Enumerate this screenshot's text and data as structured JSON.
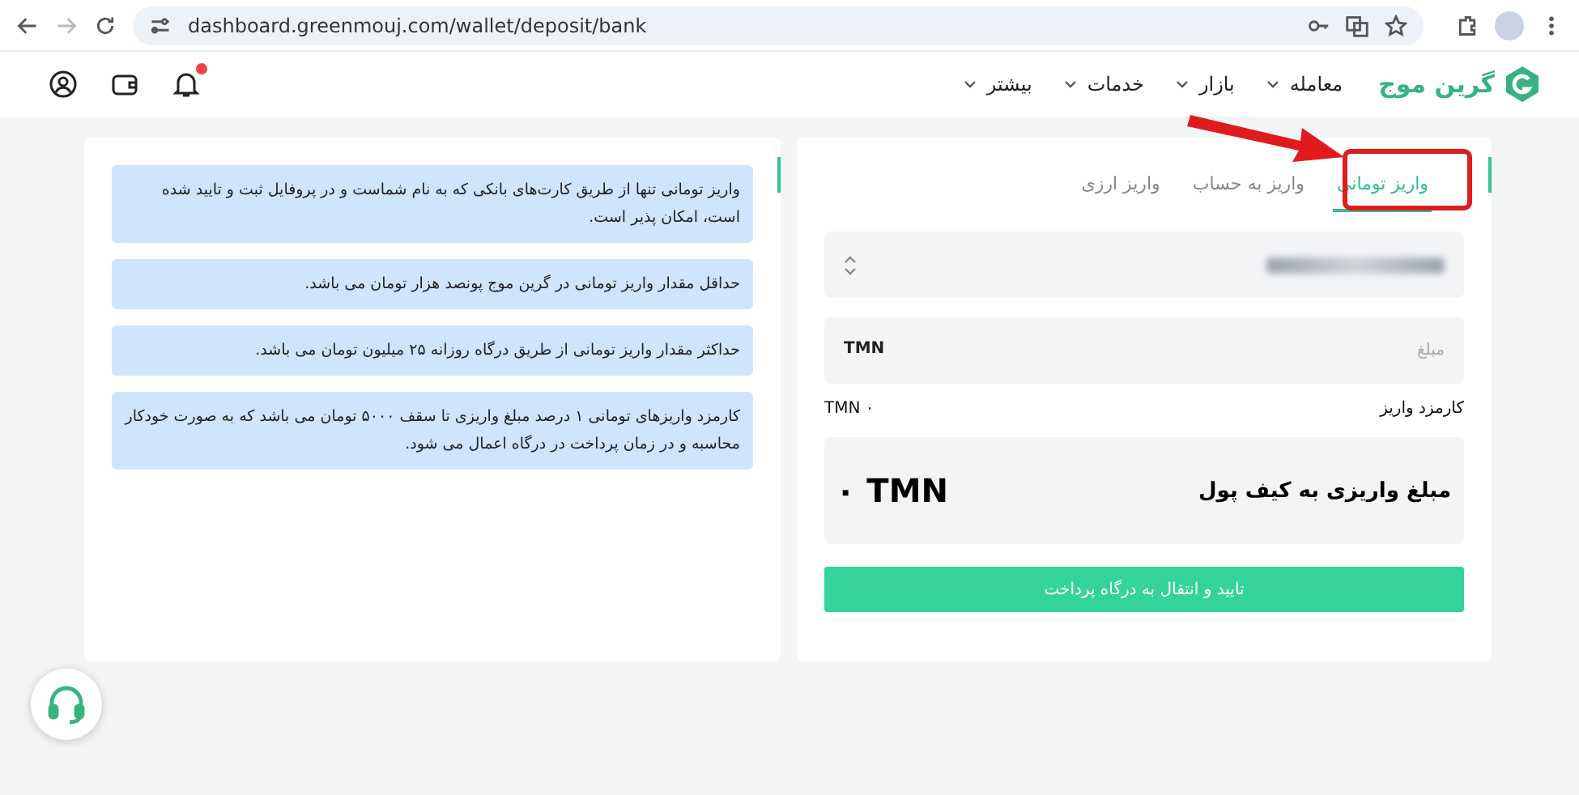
{
  "browser": {
    "url": "dashboard.greenmouj.com/wallet/deposit/bank"
  },
  "header": {
    "logo_text": "گرین موج",
    "menu": [
      {
        "label": "معامله"
      },
      {
        "label": "بازار"
      },
      {
        "label": "خدمات"
      },
      {
        "label": "بیشتر"
      }
    ],
    "notification_dot": true
  },
  "deposit": {
    "tabs": [
      {
        "label": "واریز تومانی",
        "selected": true
      },
      {
        "label": "واریز به حساب",
        "selected": false
      },
      {
        "label": "واریز ارزی",
        "selected": false
      }
    ],
    "amount_field": {
      "placeholder": "مبلغ",
      "unit": "TMN"
    },
    "fee": {
      "label": "کارمزد واریز",
      "value": "۰ TMN"
    },
    "summary": {
      "label": "مبلغ واریزی به کیف پول",
      "value": "۰ TMN"
    },
    "submit": "تایید و انتقال به درگاه پرداخت"
  },
  "notes": [
    "واریز تومانی تنها از طریق کارت‌های بانکی که به نام شماست و در پروفایل ثبت و تایید شده است، امکان پذیر است.",
    "حداقل مقدار واریز تومانی در گرین موج پونصد هزار تومان می باشد.",
    "حداکثر مقدار واریز تومانی از طریق درگاه روزانه ۲۵ میلیون تومان می باشد.",
    "کارمزد واریزهای تومانی ۱ درصد مبلغ واریزی تا سقف ۵۰۰۰ تومان می باشد که به صورت خودکار محاسبه و در زمان پرداخت در درگاه اعمال می شود."
  ]
}
